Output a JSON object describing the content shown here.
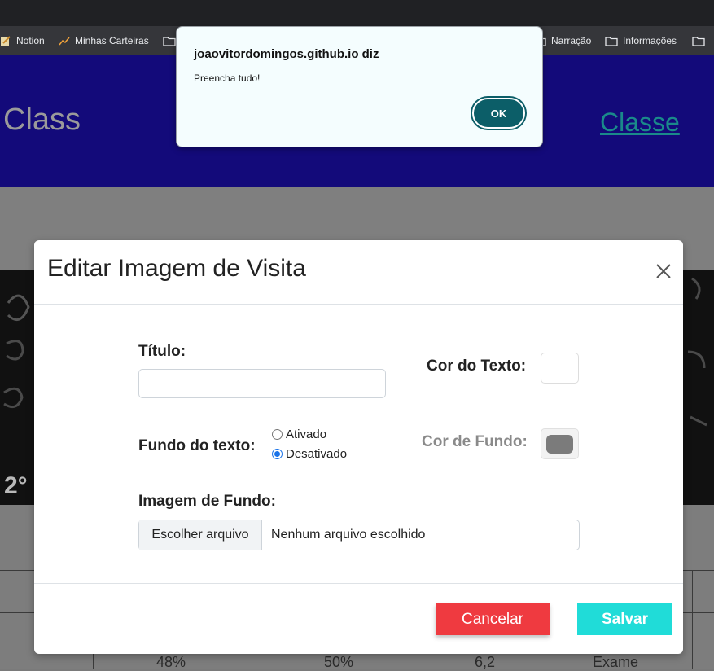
{
  "bookmarks": [
    "Notion",
    "Minhas Carteiras",
    "Narração",
    "Informações"
  ],
  "page": {
    "brand": "Class",
    "nav_link": "Classe",
    "overlay_text": "2°",
    "table_values": [
      "48%",
      "50%",
      "6,2",
      "Exame"
    ]
  },
  "modal": {
    "title": "Editar Imagem de Visita",
    "titulo_label": "Título:",
    "titulo_value": "",
    "cor_texto_label": "Cor do Texto:",
    "cor_texto_value": "#ffffff",
    "fundo_texto_label": "Fundo do texto:",
    "radio_ativado": "Ativado",
    "radio_desativado": "Desativado",
    "selected_radio": "Desativado",
    "cor_fundo_label": "Cor de Fundo:",
    "cor_fundo_value": "#7b7b7b",
    "imagem_fundo_label": "Imagem de Fundo:",
    "file_button": "Escolher arquivo",
    "file_status": "Nenhum arquivo escolhido",
    "cancel_label": "Cancelar",
    "save_label": "Salvar"
  },
  "alert": {
    "title": "joaovitordomingos.github.io diz",
    "message": "Preencha tudo!",
    "ok_label": "OK"
  },
  "colors": {
    "header_bg": "#130a7a",
    "cancel": "#ef3a40",
    "save": "#20dcd8",
    "ok": "#0c5e68"
  }
}
